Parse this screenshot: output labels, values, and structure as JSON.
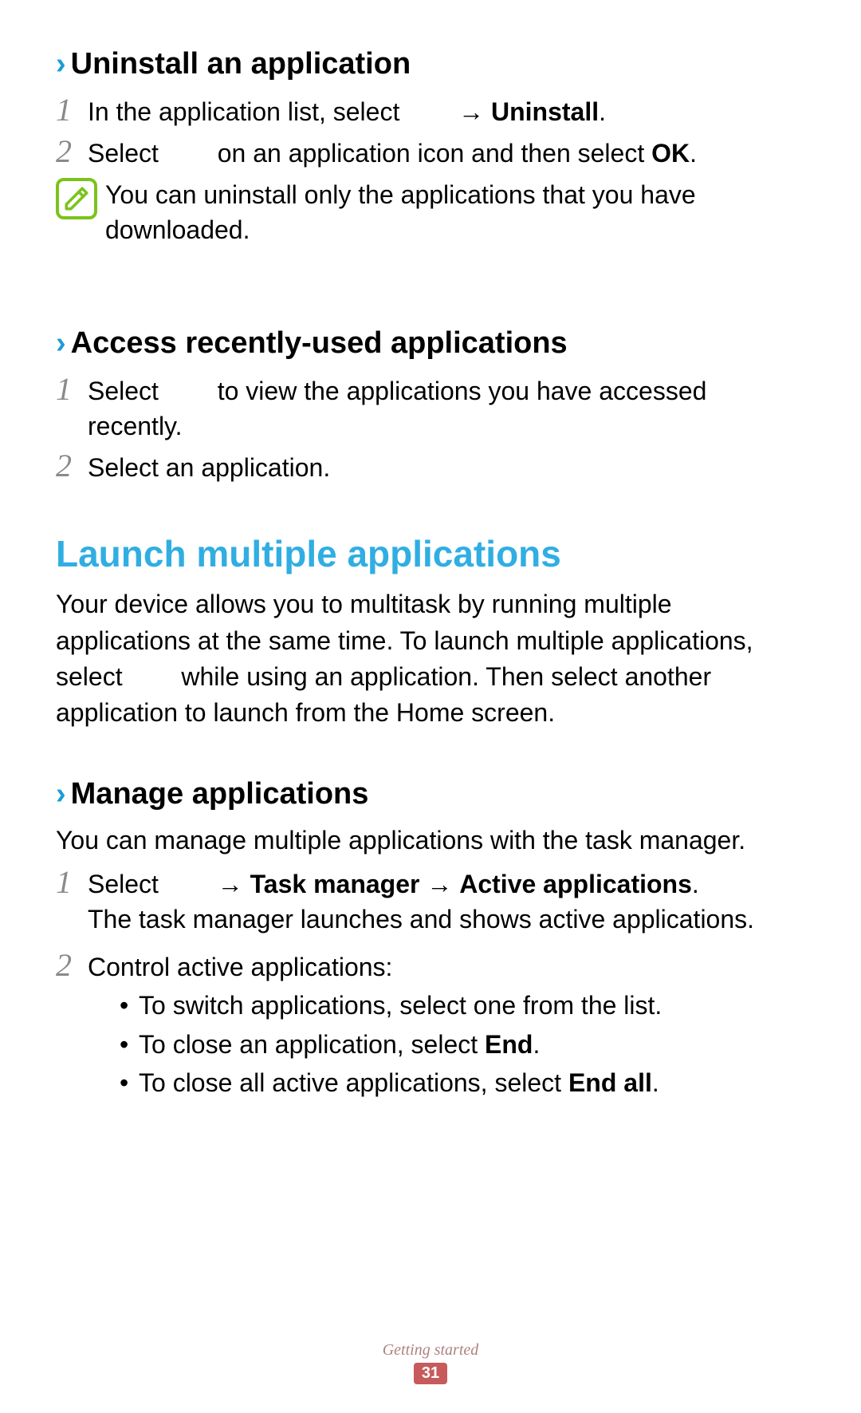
{
  "section1": {
    "heading": "Uninstall an application",
    "step1_a": "In the application list, select",
    "step1_arrow": "→",
    "step1_b": "Uninstall",
    "step1_dot": ".",
    "step2_a": "Select",
    "step2_b": "on an application icon and then select ",
    "step2_c": "OK",
    "step2_dot": ".",
    "note": "You can uninstall only the applications that you have downloaded."
  },
  "section2": {
    "heading": "Access recently-used applications",
    "step1_a": "Select",
    "step1_b": "to view the applications you have accessed recently.",
    "step2": "Select an application."
  },
  "main": {
    "heading": "Launch multiple applications",
    "para_a": "Your device allows you to multitask by running multiple applications at the same time. To launch multiple applications, select",
    "para_b": "while using an application. Then select another application to launch from the Home screen."
  },
  "section3": {
    "heading": "Manage applications",
    "intro": "You can manage multiple applications with the task manager.",
    "step1_a": "Select",
    "step1_arrow1": "→",
    "step1_b": "Task manager",
    "step1_arrow2": "→",
    "step1_c": "Active applications",
    "step1_dot": ".",
    "step1_line2": "The task manager launches and shows active applications.",
    "step2": "Control active applications:",
    "bullet1": "To switch applications, select one from the list.",
    "bullet2_a": "To close an application, select ",
    "bullet2_b": "End",
    "bullet2_dot": ".",
    "bullet3_a": "To close all active applications, select ",
    "bullet3_b": "End all",
    "bullet3_dot": "."
  },
  "footer": {
    "section": "Getting started",
    "page": "31"
  }
}
